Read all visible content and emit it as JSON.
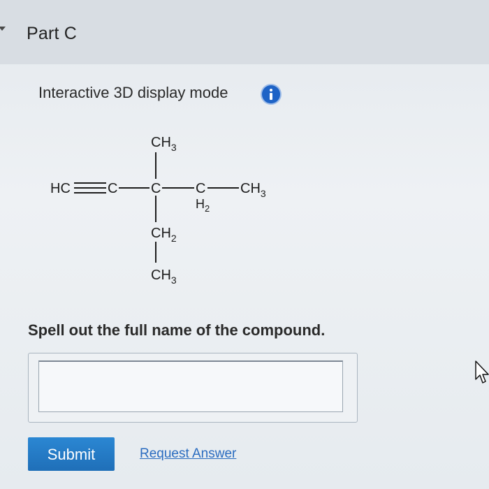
{
  "part": {
    "title": "Part C"
  },
  "display_mode": {
    "label": "Interactive 3D display mode",
    "info_icon": "info-icon"
  },
  "structure": {
    "top_ch3": "CH",
    "top_ch3_sub": "3",
    "hc": "HC",
    "c1": "C",
    "c_center": "C",
    "c_ch2": "C",
    "h2": "H",
    "h2_sub": "2",
    "right_ch3": "CH",
    "right_ch3_sub": "3",
    "mid_ch2": "CH",
    "mid_ch2_sub": "2",
    "bottom_ch3": "CH",
    "bottom_ch3_sub": "3"
  },
  "question": {
    "text": "Spell out the full name of the compound."
  },
  "answer": {
    "value": "",
    "placeholder": ""
  },
  "actions": {
    "submit_label": "Submit",
    "request_label": "Request Answer"
  },
  "colors": {
    "submit_bg": "#2179c4",
    "link": "#2a6cc0",
    "info_icon": "#1e63c6"
  }
}
